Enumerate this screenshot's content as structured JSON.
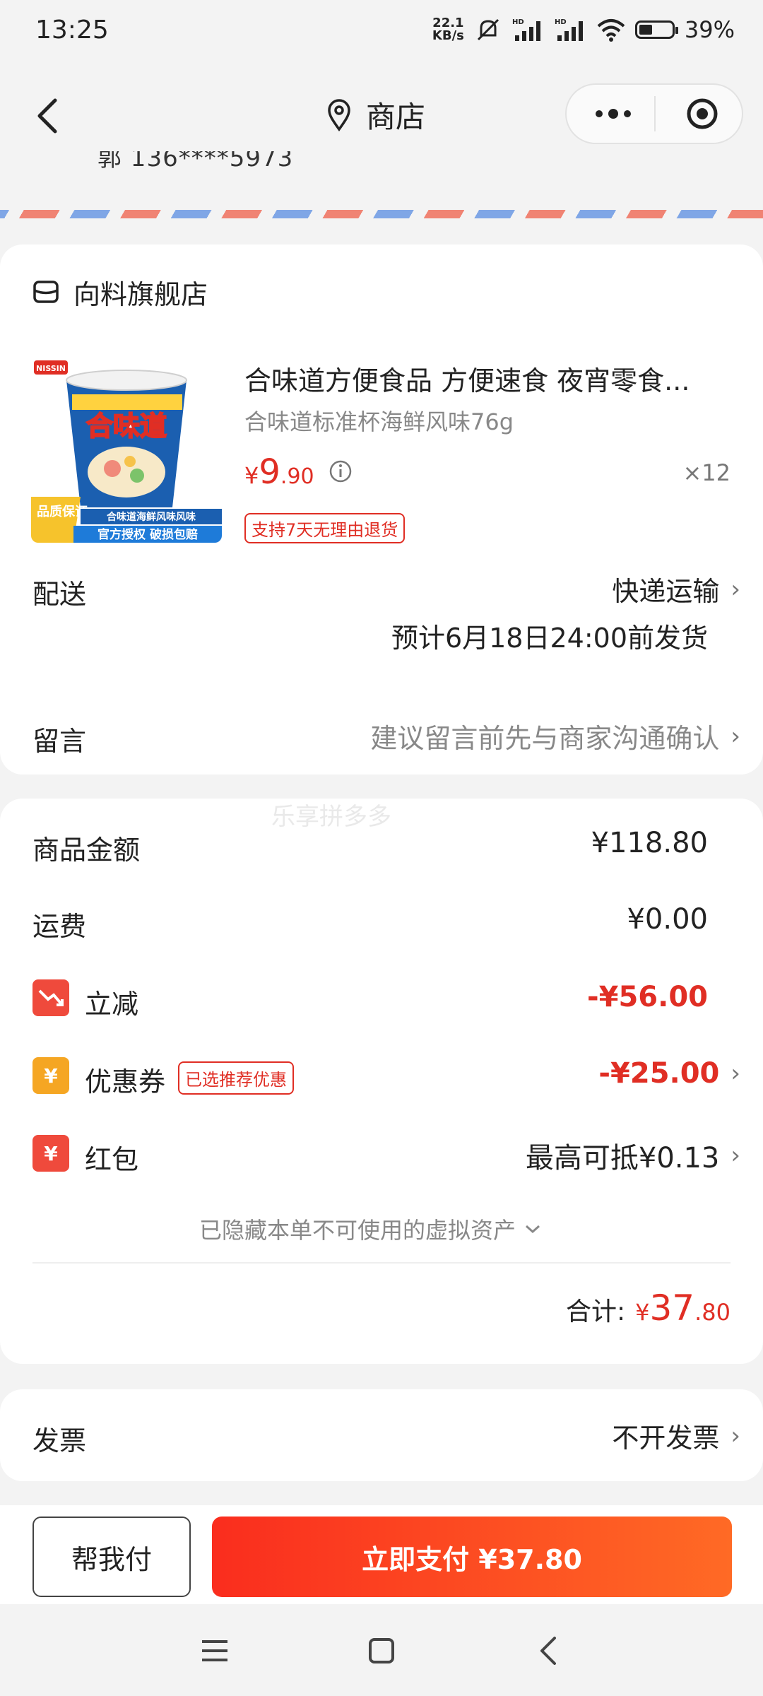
{
  "status_bar": {
    "time": "13:25",
    "net_speed_top": "22.1",
    "net_speed_bottom": "KB/s",
    "battery": "39%"
  },
  "header": {
    "title": "商店",
    "icons": [
      "back-arrow-icon",
      "location-pin-icon",
      "more-icon",
      "close-target-icon"
    ]
  },
  "address_peek": "郭 136****5973",
  "shop": {
    "name": "向料旗舰店",
    "product": {
      "title": "合味道方便食品 方便速食 夜宵零食...",
      "spec": "合味道标准杯海鲜风味76g",
      "price_symbol": "¥",
      "price_int": "9",
      "price_dec": ".90",
      "qty": "×12",
      "tag": "支持7天无理由退货",
      "image": {
        "brand": "NISSIN",
        "name": "合味道",
        "flavor": "海鲜风味",
        "badge": "品质保证",
        "banner_top": "合味道海鲜风味风味",
        "banner_bottom": "官方授权 破损包赔"
      }
    },
    "delivery": {
      "label": "配送",
      "value": "快递运输",
      "eta": "预计6月18日24:00前发货"
    },
    "message": {
      "label": "留言",
      "placeholder": "建议留言前先与商家沟通确认"
    }
  },
  "summary": {
    "watermark": "乐享拼多多",
    "goods_amount_label": "商品金额",
    "goods_amount": "¥118.80",
    "shipping_label": "运费",
    "shipping": "¥0.00",
    "discount_label": "立减",
    "discount": "-¥56.00",
    "coupon_label": "优惠券",
    "coupon_tag": "已选推荐优惠",
    "coupon": "-¥25.00",
    "redpacket_label": "红包",
    "redpacket": "最高可抵¥0.13",
    "hidden_assets": "已隐藏本单不可使用的虚拟资产",
    "total_label": "合计:",
    "total_symbol": "¥",
    "total_int": "37",
    "total_dec": ".80"
  },
  "invoice": {
    "label": "发票",
    "value": "不开发票"
  },
  "bottom_bar": {
    "help_pay": "帮我付",
    "pay_now": "立即支付 ¥37.80"
  },
  "colors": {
    "accent_red": "#e02e24",
    "pay_gradient_start": "#fa2d1e",
    "pay_gradient_end": "#ff6a25"
  }
}
